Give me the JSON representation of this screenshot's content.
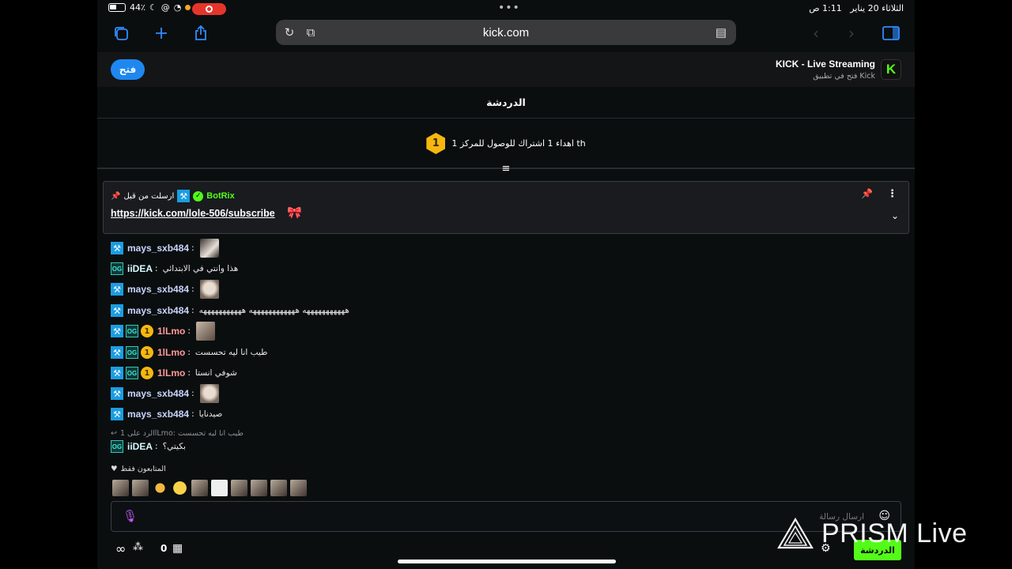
{
  "status_bar": {
    "battery": "44٪",
    "time": "1:11 ص",
    "date": "الثلاثاء 20 يناير",
    "dots": "•••"
  },
  "browser": {
    "url": "kick.com",
    "icons": [
      "tabs-icon",
      "new-tab-icon",
      "share-icon",
      "reload-icon",
      "extensions-icon",
      "reader-icon",
      "back-icon",
      "forward-icon",
      "sidebar-icon"
    ]
  },
  "banner": {
    "open_label": "فتح",
    "title": "KICK - Live Streaming",
    "subtitle": "فتح في تطبيق Kick",
    "logo": "K"
  },
  "chat": {
    "header": "الدردشة",
    "goal_text": "اهداء 1 اشتراك للوصول للمركز 1 th",
    "goal_badge": "1",
    "pinned": {
      "user": "BotRix",
      "note": "ارسلت من قبل",
      "link": "https://kick.com/lole-506/subscribe",
      "emote": "🎀"
    },
    "messages": [
      {
        "user": "mays_sxb484",
        "badges": [
          "mod"
        ],
        "text": "",
        "emote": "dark"
      },
      {
        "user": "iiDEA",
        "badges": [
          "og"
        ],
        "text": "هذا وانتي في الابتدائي"
      },
      {
        "user": "mays_sxb484",
        "badges": [
          "mod"
        ],
        "text": "",
        "emote": "face"
      },
      {
        "user": "mays_sxb484",
        "badges": [
          "mod"
        ],
        "text": "هههههههههههه ههههههههههههه هههههههههههه"
      },
      {
        "user": "1lLmo",
        "badges": [
          "mod",
          "og",
          "sub"
        ],
        "text": "",
        "emote": "photo"
      },
      {
        "user": "1lLmo",
        "badges": [
          "mod",
          "og",
          "sub"
        ],
        "text": "طيب انا ليه تحسست"
      },
      {
        "user": "1lLmo",
        "badges": [
          "mod",
          "og",
          "sub"
        ],
        "text": "شوفي انستا"
      },
      {
        "user": "mays_sxb484",
        "badges": [
          "mod"
        ],
        "text": "",
        "emote": "face"
      },
      {
        "user": "mays_sxb484",
        "badges": [
          "mod"
        ],
        "text": "صيدنايا"
      }
    ],
    "reply_context": "الرد على 1lLmo: طيب انا ليه تحسست",
    "reply_message": {
      "user": "iiDEA",
      "badges": [
        "og"
      ],
      "text": "بكيتي؟"
    },
    "followers_only": "المتابعون فقط",
    "input_placeholder": "ارسال رسالة",
    "count": "0",
    "send_label": "الدردشة",
    "sub_badge": "1",
    "og_badge": "OG",
    "mod_badge": "⚒"
  },
  "watermark": "PRISM Live",
  "colors": {
    "kick_green": "#53fc18",
    "accent_blue": "#2f8cff",
    "sub_gold": "#f6b80f",
    "background": "#0b0e0f"
  }
}
